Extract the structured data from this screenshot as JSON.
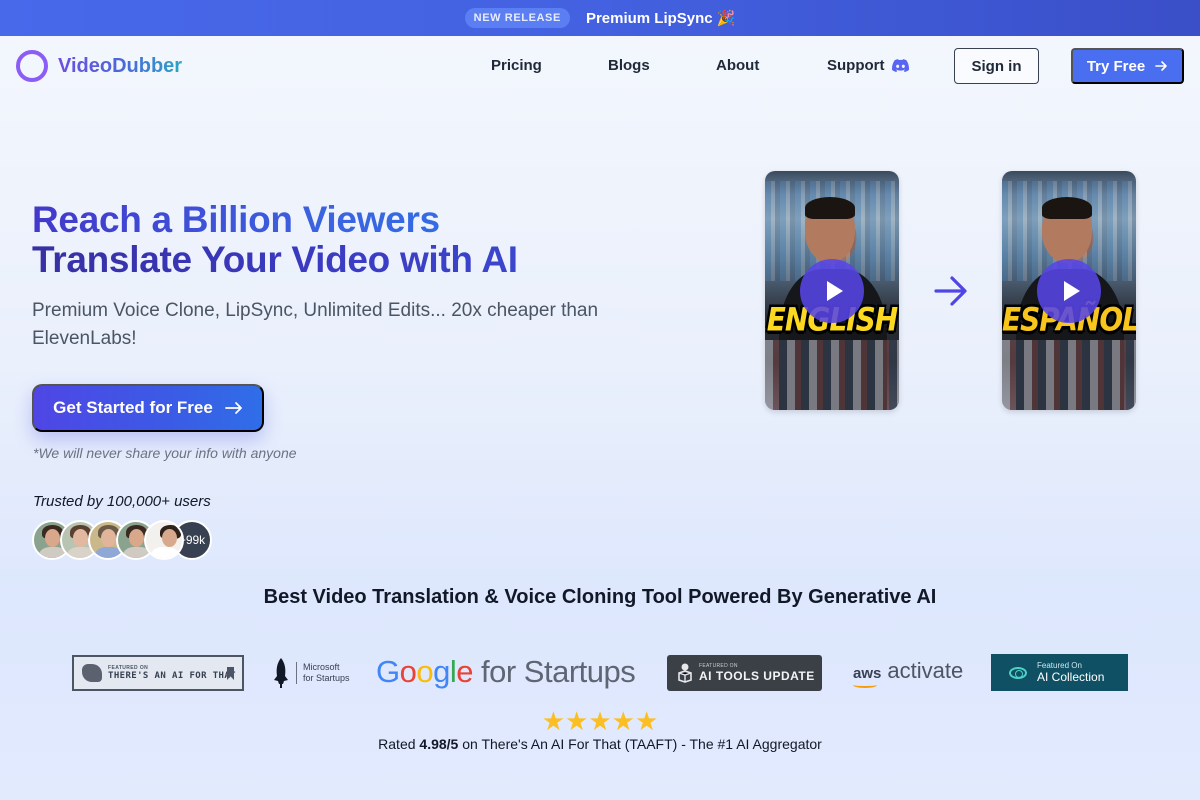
{
  "announcement": {
    "badge": "NEW RELEASE",
    "text": "Premium LipSync",
    "emoji": "🎉"
  },
  "nav": {
    "brand": "VideoDubber",
    "links": [
      {
        "label": "Pricing"
      },
      {
        "label": "Blogs"
      },
      {
        "label": "About"
      },
      {
        "label": "Support",
        "icon": "discord-icon"
      }
    ],
    "signin_label": "Sign in",
    "tryfree_label": "Try Free",
    "tryfree_icon": "arrow-right-icon"
  },
  "hero": {
    "title_line1": "Reach a Billion Viewers",
    "title_line2": "Translate Your Video with AI",
    "subtitle": "Premium Voice Clone, LipSync, Unlimited Edits... 20x cheaper than ElevenLabs!",
    "cta_label": "Get Started for Free",
    "cta_arrow": "→",
    "privacy_note": "*We will never share your info with anyone",
    "trusted_text": "Trusted by 100,000+ users",
    "avatar_more": "+99k"
  },
  "videos": {
    "source": {
      "caption": "ENGLISH"
    },
    "target": {
      "caption": "ESPAÑOL"
    },
    "arrow_icon": "arrow-right-icon"
  },
  "features": {
    "headline": "Best Video Translation & Voice Cloning Tool Powered By Generative AI",
    "logos": {
      "taaft_small": "FEATURED ON",
      "taaft_big": "THERE'S AN AI FOR THAT",
      "microsoft_line1": "Microsoft",
      "microsoft_line2": "for Startups",
      "google_word": [
        "G",
        "o",
        "o",
        "g",
        "l",
        "e"
      ],
      "google_rest": "for Startups",
      "aitools_small": "FEATURED ON",
      "aitools_big": "AI TOOLS UPDATE",
      "aws_word": "aws",
      "aws_activate": "activate",
      "aicollection_small": "Featured On",
      "aicollection_big": "AI Collection"
    },
    "stars": "★★★★★",
    "rating_prefix": "Rated",
    "rating_value": "4.98/5",
    "rating_suffix": "on There's An AI For That (TAAFT) - The #1 AI Aggregator"
  },
  "colors": {
    "accent": "#4a6ef0",
    "topbar": "#4361e0",
    "logo_ring": "#8b5cf6",
    "star": "#fbbf24"
  }
}
